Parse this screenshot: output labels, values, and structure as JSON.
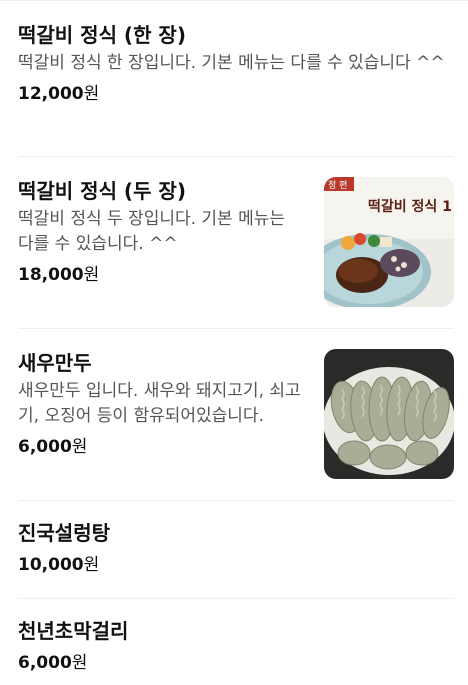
{
  "menu": {
    "items": [
      {
        "name": "떡갈비 정식 (한 장)",
        "description": "떡갈비 정식 한 장입니다. 기본 메뉴는 다를 수 있습니다 ^^",
        "price": "12,000",
        "currency": "원"
      },
      {
        "name": "떡갈비 정식 (두 장)",
        "description": "떡갈비 정식 두 장입니다. 기본 메뉴는 다를 수 있습니다. ^^",
        "price": "18,000",
        "currency": "원",
        "image_text": "떡갈비 정식 1",
        "image_badge": "정 편"
      },
      {
        "name": "새우만두",
        "description": "새우만두 입니다. 새우와 돼지고기, 쇠고기, 오징어 등이 함유되어있습니다.",
        "price": "6,000",
        "currency": "원"
      },
      {
        "name": "진국설렁탕",
        "price": "10,000",
        "currency": "원"
      },
      {
        "name": "천년초막걸리",
        "price": "6,000",
        "currency": "원"
      }
    ]
  }
}
